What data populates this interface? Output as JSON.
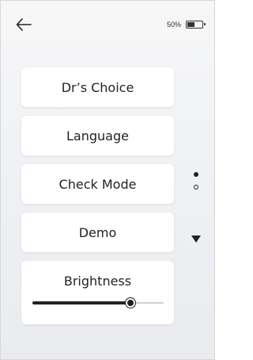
{
  "header": {
    "back_icon": "back-arrow-icon",
    "battery_percent_label": "50%",
    "battery_level": 0.5,
    "battery_icon": "battery-icon"
  },
  "menu": {
    "items": [
      {
        "label": "Dr’s Choice"
      },
      {
        "label": "Language"
      },
      {
        "label": "Check Mode"
      },
      {
        "label": "Demo"
      }
    ],
    "brightness": {
      "label": "Brightness",
      "value": 0.75
    }
  },
  "pager": {
    "pages": 2,
    "current": 1
  },
  "scroll": {
    "down_icon": "triangle-down-icon"
  }
}
